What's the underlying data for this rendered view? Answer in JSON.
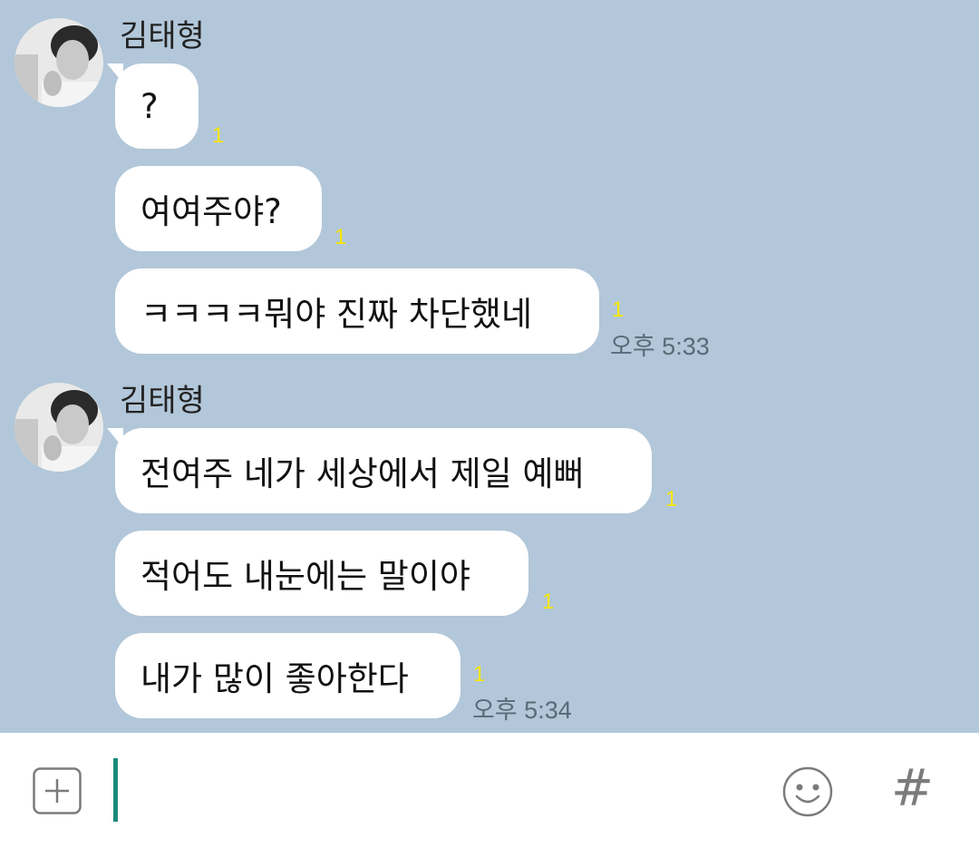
{
  "chat": {
    "groups": [
      {
        "sender": "김태형",
        "messages": [
          {
            "text": "?",
            "unread": "1"
          },
          {
            "text": "여여주야?",
            "unread": "1"
          },
          {
            "text": "ㅋㅋㅋㅋ뭐야 진짜 차단했네",
            "unread": "1",
            "time": "오후 5:33"
          }
        ]
      },
      {
        "sender": "김태형",
        "messages": [
          {
            "text": "전여주 네가 세상에서 제일 예뻐",
            "unread": "1"
          },
          {
            "text": "적어도 내눈에는 말이야",
            "unread": "1"
          },
          {
            "text": "내가 많이 좋아한다",
            "unread": "1",
            "time": "오후 5:34"
          }
        ]
      }
    ]
  },
  "input": {
    "plus_icon": "plus-square-icon",
    "emoji_icon": "smiley-icon",
    "hash_label": "#"
  },
  "colors": {
    "chat_background": "#b2c7d9",
    "bubble": "#ffffff",
    "unread": "#f7e600",
    "cursor": "#1a8a7a"
  }
}
